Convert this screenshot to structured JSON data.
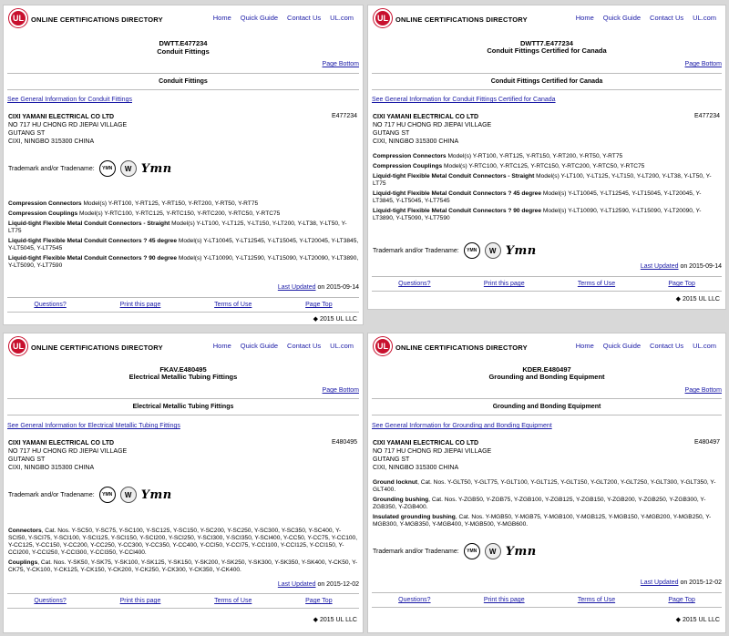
{
  "header": {
    "logo": "UL",
    "brand": "ONLINE CERTIFICATIONS DIRECTORY",
    "nav": [
      "Home",
      "Quick Guide",
      "Contact Us",
      "UL.com"
    ]
  },
  "common": {
    "page_bottom": "Page Bottom",
    "trademark_label": "Trademark and/or Tradename:",
    "tm_ymn_logo": "YMN",
    "tm_w_logo": "W",
    "tm_script": "Ymn",
    "last_updated_label": "Last Updated",
    "footer": [
      "Questions?",
      "Print this page",
      "Terms of Use",
      "Page Top"
    ],
    "copyright": "◆ 2015 UL LLC"
  },
  "company": {
    "name": "CIXI YAMANI ELECTRICAL CO LTD",
    "address1": "NO 717 HU CHONG RD JIEPAI VILLAGE",
    "address2": "GUTANG ST",
    "address3": "CIXI, NINGBO 315300 CHINA"
  },
  "panels": [
    {
      "code": "DWTT.E477234",
      "subtitle": "Conduit Fittings",
      "section": "Conduit Fittings",
      "general_link": "See General Information for Conduit Fittings",
      "file_no": "E477234",
      "updated_date": "on 2015-09-14",
      "products": [
        {
          "label": "Compression Connectors",
          "text": " Model(s) Y-RT100, Y-RT125, Y-RT150, Y-RT200, Y-RT50, Y-RT75"
        },
        {
          "label": "Compression Couplings",
          "text": " Model(s) Y-RTC100, Y-RTC125, Y-RTC150, Y-RTC200, Y-RTC50, Y-RTC75"
        },
        {
          "label": "Liquid-tight Flexible Metal Conduit Connectors - Straight",
          "text": " Model(s) Y-LT100, Y-LT125, Y-LT150, Y-LT200, Y-LT38, Y-LT50, Y-LT75"
        },
        {
          "label": "Liquid-tight Flexible Metal Conduit Connectors ? 45 degree",
          "text": " Model(s) Y-LT10045, Y-LT12545, Y-LT15045, Y-LT20045, Y-LT3845, Y-LT5045, Y-LT7545"
        },
        {
          "label": "Liquid-tight Flexible Metal Conduit Connectors ? 90 degree",
          "text": " Model(s) Y-LT10090, Y-LT12590, Y-LT15090, Y-LT20090, Y-LT3890, Y-LT5090, Y-LT7590"
        }
      ]
    },
    {
      "code": "DWTT7.E477234",
      "subtitle": "Conduit Fittings Certified for Canada",
      "section": "Conduit Fittings Certified for Canada",
      "general_link": "See General Information for Conduit Fittings Certified for Canada",
      "file_no": "E477234",
      "updated_date": "on 2015-09-14",
      "products": [
        {
          "label": "Compression Connectors",
          "text": " Model(s) Y-RT100, Y-RT125, Y-RT150, Y-RT200, Y-RT50, Y-RT75"
        },
        {
          "label": "Compression Couplings",
          "text": " Model(s) Y-RTC100, Y-RTC125, Y-RTC150, Y-RTC200, Y-RTC50, Y-RTC75"
        },
        {
          "label": "Liquid-tight Flexible Metal Conduit Connectors - Straight",
          "text": " Model(s) Y-LT100, Y-LT125, Y-LT150, Y-LT200, Y-LT38, Y-LT50, Y-LT75"
        },
        {
          "label": "Liquid-tight Flexible Metal Conduit Connectors ? 45 degree",
          "text": " Model(s) Y-LT10045, Y-LT12545, Y-LT15045, Y-LT20045, Y-LT3845, Y-LT5045, Y-LT7545"
        },
        {
          "label": "Liquid-tight Flexible Metal Conduit Connectors ? 90 degree",
          "text": " Model(s) Y-LT10090, Y-LT12590, Y-LT15090, Y-LT20090, Y-LT3890, Y-LT5090, Y-LT7590"
        }
      ]
    },
    {
      "code": "FKAV.E480495",
      "subtitle": "Electrical Metallic Tubing Fittings",
      "section": "Electrical Metallic Tubing Fittings",
      "general_link": "See General Information for Electrical Metallic Tubing Fittings",
      "file_no": "E480495",
      "updated_date": "on 2015-12-02",
      "products": [
        {
          "label": "Connectors",
          "text": ", Cat. Nos. Y-SC50, Y-SC75, Y-SC100, Y-SC125, Y-SC150, Y-SC200, Y-SC250, Y-SC300, Y-SC350, Y-SC400, Y-SCI50, Y-SCI75, Y-SCI100, Y-SCI125, Y-SCI150, Y-SCI200, Y-SCI250, Y-SCI300, Y-SCI350, Y-SCI400, Y-CC50, Y-CC75, Y-CC100, Y-CC125, Y-CC150, Y-CC200, Y-CC250, Y-CC300, Y-CC350, Y-CC400, Y-CCI50, Y-CCI75, Y-CCI100, Y-CCI125, Y-CCI150, Y-CCI200, Y-CCI250, Y-CCI300, Y-CCI350, Y-CCI400."
        },
        {
          "label": "Couplings",
          "text": ", Cat. Nos. Y-SK50, Y-SK75, Y-SK100, Y-SK125, Y-SK150, Y-SK200, Y-SK250, Y-SK300, Y-SK350, Y-SK400, Y-CK50, Y-CK75, Y-CK100, Y-CK125, Y-CK150, Y-CK200, Y-CK250, Y-CK300, Y-CK350, Y-CK400."
        }
      ]
    },
    {
      "code": "KDER.E480497",
      "subtitle": "Grounding and Bonding Equipment",
      "section": "Grounding and Bonding Equipment",
      "general_link": "See General Information for Grounding and Bonding Equipment",
      "file_no": "E480497",
      "updated_date": "on 2015-12-02",
      "products": [
        {
          "label": "Ground locknut",
          "text": ", Cat. Nos. Y-GLT50, Y-GLT75, Y-GLT100, Y-GLT125, Y-GLT150, Y-GLT200, Y-GLT250, Y-GLT300, Y-GLT350, Y-GLT400."
        },
        {
          "label": "Grounding bushing",
          "text": ", Cat. Nos. Y-ZGB50, Y-ZGB75, Y-ZGB100, Y-ZGB125, Y-ZGB150, Y-ZGB200, Y-ZGB250, Y-ZGB300, Y-ZGB350, Y-ZGB400."
        },
        {
          "label": "Insulated grounding bushing",
          "text": ", Cat. Nos. Y-MGB50, Y-MGB75, Y-MGB100, Y-MGB125, Y-MGB150, Y-MGB200, Y-MGB250, Y-MGB300, Y-MGB350, Y-MGB400, Y-MGB500, Y-MGB600."
        }
      ]
    }
  ]
}
